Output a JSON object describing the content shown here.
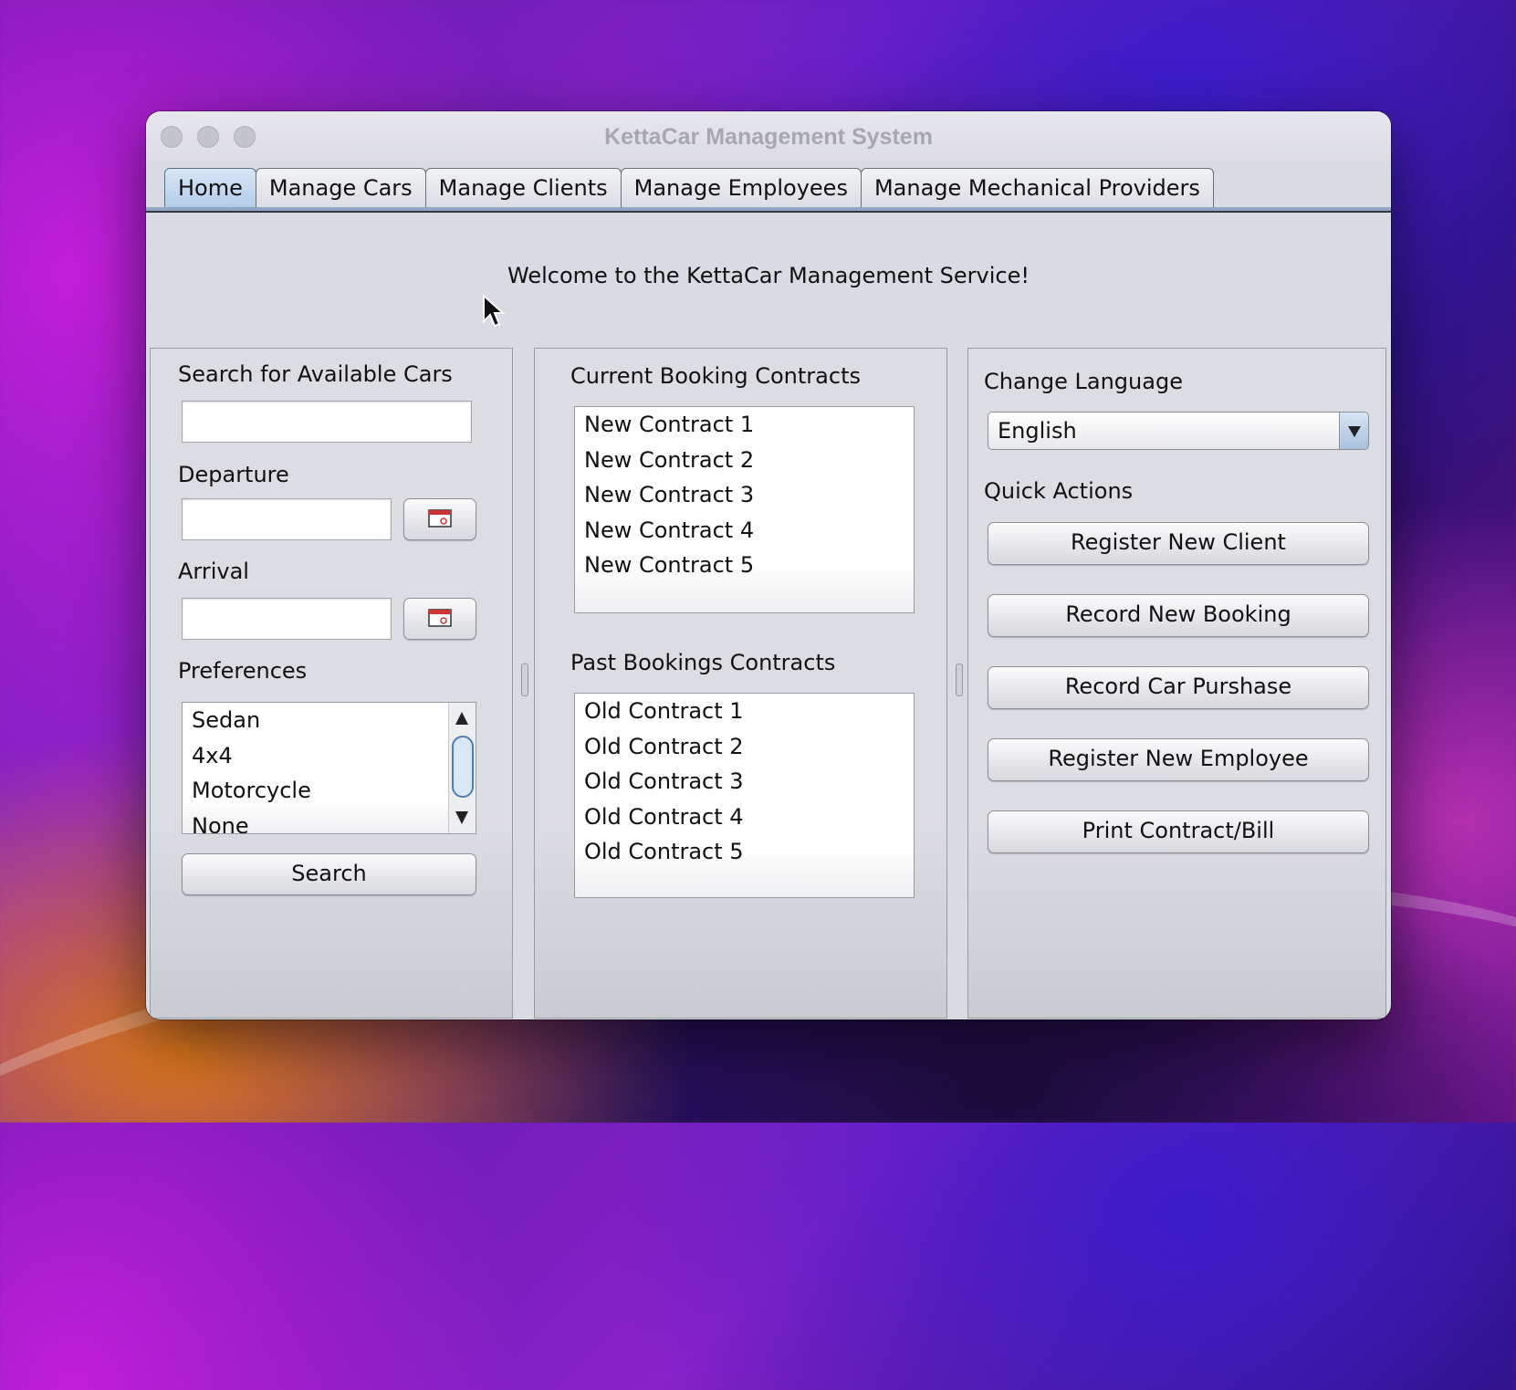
{
  "window": {
    "title": "KettaCar Management System"
  },
  "tabs": [
    {
      "label": "Home",
      "active": true
    },
    {
      "label": "Manage Cars"
    },
    {
      "label": "Manage Clients"
    },
    {
      "label": "Manage Employees"
    },
    {
      "label": "Manage Mechanical Providers"
    }
  ],
  "welcome": "Welcome to the KettaCar Management Service!",
  "search_panel": {
    "title": "Search for Available Cars",
    "search_value": "",
    "departure_label": "Departure",
    "departure_value": "",
    "arrival_label": "Arrival",
    "arrival_value": "",
    "date_picker_icon": "calendar-icon",
    "preferences_label": "Preferences",
    "preferences": [
      "Sedan",
      "4x4",
      "Motorcycle",
      "None"
    ],
    "search_button": "Search"
  },
  "contracts_panel": {
    "current_title": "Current Booking Contracts",
    "current": [
      "New Contract 1",
      "New Contract 2",
      "New Contract 3",
      "New Contract 4",
      "New Contract 5"
    ],
    "past_title": "Past Bookings Contracts",
    "past": [
      "Old Contract 1",
      "Old Contract 2",
      "Old Contract 3",
      "Old Contract 4",
      "Old Contract 5"
    ]
  },
  "actions_panel": {
    "language_label": "Change Language",
    "language_value": "English",
    "quick_actions_label": "Quick Actions",
    "buttons": [
      "Register New Client",
      "Record New Booking",
      "Record Car Purshase",
      "Register New Employee",
      "Print Contract/Bill"
    ]
  }
}
